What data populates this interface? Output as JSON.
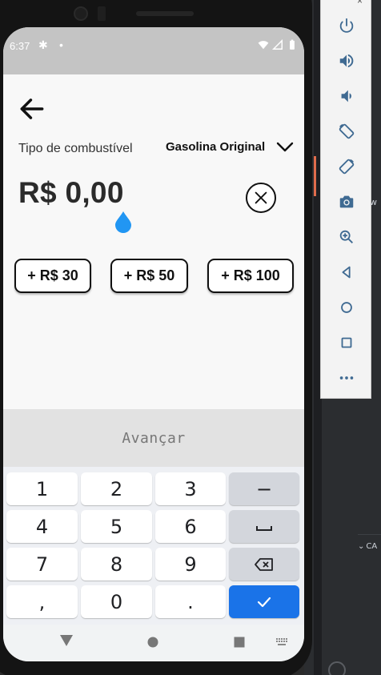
{
  "status_bar": {
    "time": "6:37"
  },
  "screen": {
    "fuel_label": "Tipo de combustível",
    "fuel_value": "Gasolina Original",
    "amount": "R$ 0,00",
    "quick_amounts": [
      "+ R$ 30",
      "+ R$ 50",
      "+ R$ 100"
    ]
  },
  "keyboard": {
    "action_label": "Avançar",
    "keys": {
      "k1": "1",
      "k2": "2",
      "k3": "3",
      "minus": "−",
      "k4": "4",
      "k5": "5",
      "k6": "6",
      "k7": "7",
      "k8": "8",
      "k9": "9",
      "comma": ",",
      "k0": "0",
      "period": "."
    }
  },
  "ide": {
    "side_text": "w",
    "bottom_tab": "CA"
  },
  "colors": {
    "accent": "#1a73e8",
    "drop": "#2196f3",
    "status_bar": "#c4c4c4",
    "toolbar_icon": "#3f6a92"
  },
  "icons": {
    "status": [
      "gear-icon",
      "wifi-icon",
      "signal-icon",
      "battery-icon"
    ],
    "emulator_toolbar": [
      "power-icon",
      "volume-up-icon",
      "volume-down-icon",
      "rotate-left-icon",
      "rotate-right-icon",
      "camera-icon",
      "zoom-icon",
      "back-icon",
      "home-icon",
      "overview-icon",
      "more-icon"
    ]
  }
}
